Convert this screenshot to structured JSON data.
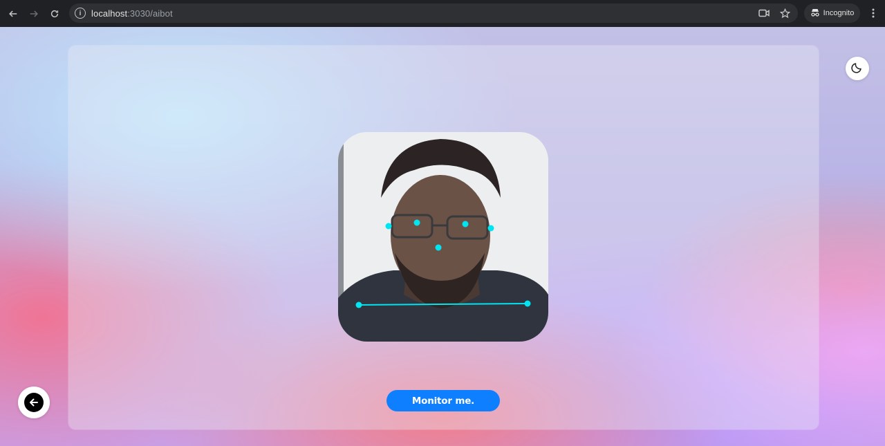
{
  "browser": {
    "url_host": "localhost",
    "url_path": ":3030/aibot",
    "mode_label": "Incognito",
    "icons": [
      "back-arrow-icon",
      "forward-arrow-icon",
      "reload-icon",
      "site-info-icon",
      "camera-icon",
      "star-icon",
      "incognito-icon",
      "more-vert-icon"
    ]
  },
  "page": {
    "theme_toggle_icon": "moon-icon",
    "back_button_icon": "arrow-left-icon",
    "monitor_button_label": "Monitor me.",
    "colors": {
      "button": "#0d7fff",
      "landmarks": "#00e5f0"
    }
  }
}
